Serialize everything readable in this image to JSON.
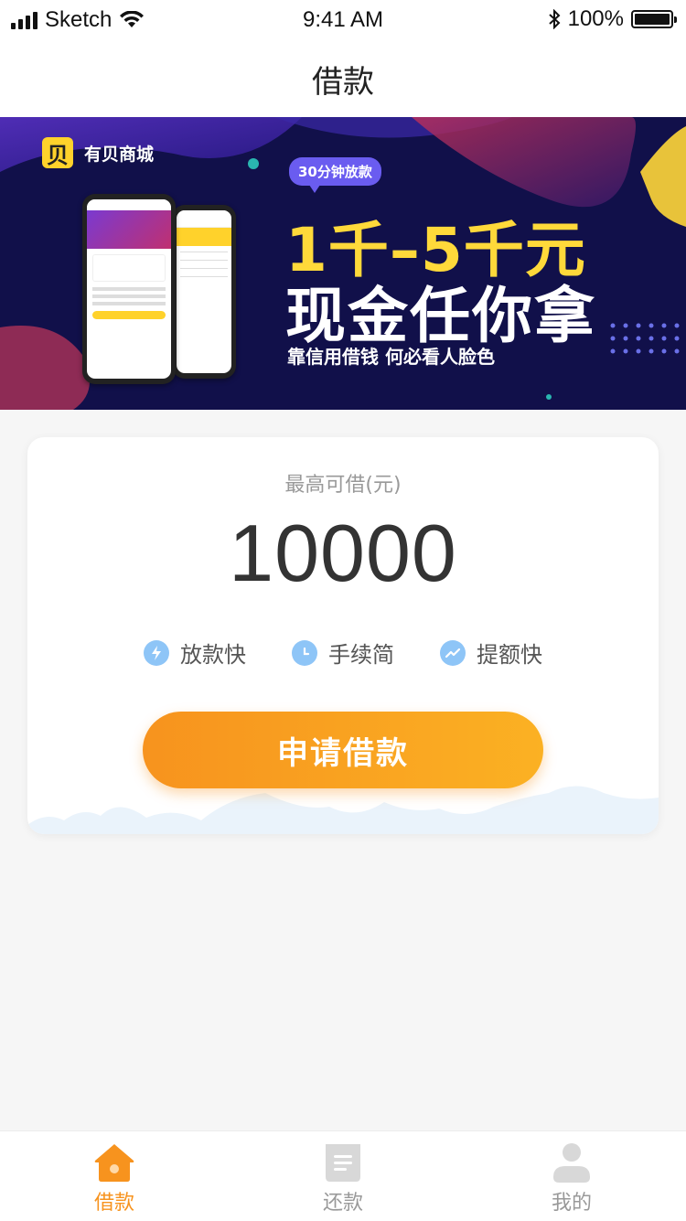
{
  "status_bar": {
    "carrier": "Sketch",
    "time": "9:41 AM",
    "battery": "100%"
  },
  "nav": {
    "title": "借款"
  },
  "banner": {
    "brand": "有贝商城",
    "logo_char": "贝",
    "badge": "30分钟放款",
    "headline_1": "1千–5千元",
    "headline_2": "现金任你拿",
    "slogan": "靠信用借钱   何必看人脸色",
    "accent": "#ffd93a"
  },
  "card": {
    "label": "最高可借(元)",
    "amount": "10000",
    "features": [
      {
        "label": "放款快",
        "icon": "lightning-icon"
      },
      {
        "label": "手续简",
        "icon": "clock-icon"
      },
      {
        "label": "提额快",
        "icon": "trend-up-icon"
      }
    ],
    "apply_label": "申请借款",
    "button_colors": [
      "#f7931e",
      "#fbb123"
    ]
  },
  "tabbar": {
    "items": [
      {
        "label": "借款",
        "icon": "home-icon",
        "active": true
      },
      {
        "label": "还款",
        "icon": "document-icon",
        "active": false
      },
      {
        "label": "我的",
        "icon": "user-icon",
        "active": false
      }
    ],
    "active_color": "#f7931e"
  }
}
